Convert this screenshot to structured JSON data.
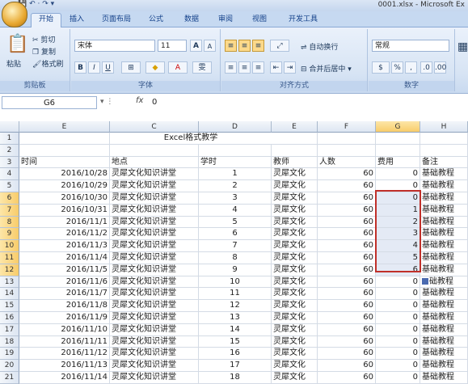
{
  "window": {
    "title": "0001.xlsx - Microsoft Ex"
  },
  "tabs": [
    "开始",
    "插入",
    "页面布局",
    "公式",
    "数据",
    "审阅",
    "视图",
    "开发工具"
  ],
  "ribbon": {
    "clipboard": {
      "paste": "粘贴",
      "cut": "剪切",
      "copy": "复制",
      "format_painter": "格式刷",
      "label": "剪贴板"
    },
    "font": {
      "name": "宋体",
      "size": "11",
      "bold": "B",
      "italic": "I",
      "underline": "U",
      "grow": "A",
      "shrink": "A",
      "wen": "雯",
      "label": "字体"
    },
    "alignment": {
      "wrap": "自动换行",
      "merge": "合并后居中",
      "label": "对齐方式"
    },
    "number": {
      "format": "常规",
      "label": "数字",
      "currency": "%",
      "comma": ",",
      "percent": "%"
    }
  },
  "formula_bar": {
    "name_box": "G6",
    "fx": "fx",
    "value": "0"
  },
  "columns": [
    "E",
    "C",
    "D",
    "E",
    "F",
    "G",
    "H"
  ],
  "sheet": {
    "title": "Excel格式教学",
    "headers": [
      "时间",
      "地点",
      "学时",
      "教师",
      "人数",
      "费用",
      "备注"
    ],
    "rows": [
      [
        "2016/10/28",
        "灵犀文化知识讲堂",
        "1",
        "灵犀文化",
        "60",
        "0",
        "基础教程"
      ],
      [
        "2016/10/29",
        "灵犀文化知识讲堂",
        "2",
        "灵犀文化",
        "60",
        "0",
        "基础教程"
      ],
      [
        "2016/10/30",
        "灵犀文化知识讲堂",
        "3",
        "灵犀文化",
        "60",
        "0",
        "基础教程"
      ],
      [
        "2016/10/31",
        "灵犀文化知识讲堂",
        "4",
        "灵犀文化",
        "60",
        "1",
        "基础教程"
      ],
      [
        "2016/11/1",
        "灵犀文化知识讲堂",
        "5",
        "灵犀文化",
        "60",
        "2",
        "基础教程"
      ],
      [
        "2016/11/2",
        "灵犀文化知识讲堂",
        "6",
        "灵犀文化",
        "60",
        "3",
        "基础教程"
      ],
      [
        "2016/11/3",
        "灵犀文化知识讲堂",
        "7",
        "灵犀文化",
        "60",
        "4",
        "基础教程"
      ],
      [
        "2016/11/4",
        "灵犀文化知识讲堂",
        "8",
        "灵犀文化",
        "60",
        "5",
        "基础教程"
      ],
      [
        "2016/11/5",
        "灵犀文化知识讲堂",
        "9",
        "灵犀文化",
        "60",
        "6",
        "基础教程"
      ],
      [
        "2016/11/6",
        "灵犀文化知识讲堂",
        "10",
        "灵犀文化",
        "60",
        "0",
        "础教程"
      ],
      [
        "2016/11/7",
        "灵犀文化知识讲堂",
        "11",
        "灵犀文化",
        "60",
        "0",
        "基础教程"
      ],
      [
        "2016/11/8",
        "灵犀文化知识讲堂",
        "12",
        "灵犀文化",
        "60",
        "0",
        "基础教程"
      ],
      [
        "2016/11/9",
        "灵犀文化知识讲堂",
        "13",
        "灵犀文化",
        "60",
        "0",
        "基础教程"
      ],
      [
        "2016/11/10",
        "灵犀文化知识讲堂",
        "14",
        "灵犀文化",
        "60",
        "0",
        "基础教程"
      ],
      [
        "2016/11/11",
        "灵犀文化知识讲堂",
        "15",
        "灵犀文化",
        "60",
        "0",
        "基础教程"
      ],
      [
        "2016/11/12",
        "灵犀文化知识讲堂",
        "16",
        "灵犀文化",
        "60",
        "0",
        "基础教程"
      ],
      [
        "2016/11/13",
        "灵犀文化知识讲堂",
        "17",
        "灵犀文化",
        "60",
        "0",
        "基础教程"
      ],
      [
        "2016/11/14",
        "灵犀文化知识讲堂",
        "18",
        "灵犀文化",
        "60",
        "0",
        "基础教程"
      ]
    ]
  }
}
